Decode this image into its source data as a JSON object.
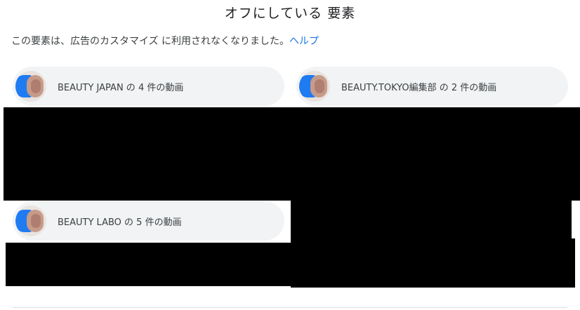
{
  "header": {
    "title": "オフにしている 要素",
    "description": "この要素は、広告のカスタマイズ に利用されなくなりました。",
    "help_link": "ヘルプ"
  },
  "items": [
    {
      "label": "BEAUTY JAPAN の 4 件の動画"
    },
    {
      "label": "BEAUTY.TOKYO編集部 の 2 件の動画"
    },
    {
      "label": "BEAUTY LABO の 5 件の動画"
    }
  ],
  "colors": {
    "chip_background": "#f1f3f4",
    "link": "#1a73e8",
    "redaction": "#000000"
  }
}
